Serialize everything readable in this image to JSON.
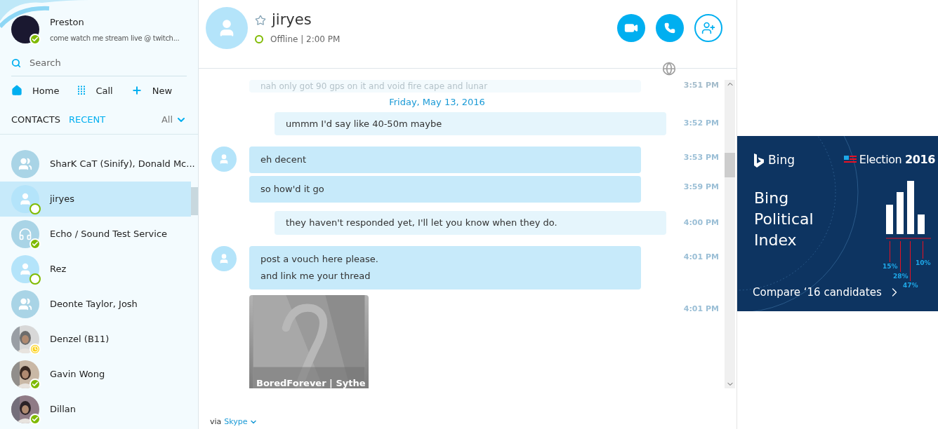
{
  "profile": {
    "name": "Preston",
    "mood": "come watch me stream live @ twitch...",
    "status": {
      "kind": "online"
    }
  },
  "search": {
    "placeholder": "Search"
  },
  "nav": [
    {
      "kind": "home",
      "label": "Home"
    },
    {
      "kind": "dialpad",
      "label": "Call"
    },
    {
      "kind": "plus",
      "label": "New"
    }
  ],
  "tabs": [
    {
      "label": "CONTACTS",
      "selected": false
    },
    {
      "label": "RECENT",
      "selected": true
    }
  ],
  "filter": "All",
  "contacts": [
    {
      "name": "SharK CaT (Sinify), Donald Mc...",
      "kind": "group",
      "selected": false
    },
    {
      "name": "jiryes",
      "kind": "person",
      "status": {
        "kind": "offline"
      },
      "selected": true
    },
    {
      "name": "Echo / Sound Test Service",
      "kind": "headset",
      "status": {
        "kind": "online"
      },
      "selected": false
    },
    {
      "name": "Rez",
      "kind": "person",
      "status": {
        "kind": "offline"
      },
      "selected": false
    },
    {
      "name": "Deonte Taylor, Josh",
      "kind": "group",
      "selected": false
    },
    {
      "name": "Denzel (B11)",
      "kind": "picture",
      "status": {
        "kind": "away"
      },
      "selected": false
    },
    {
      "name": "Gavin Wong",
      "kind": "picture",
      "status": {
        "kind": "online"
      },
      "selected": false
    },
    {
      "name": "Dillan",
      "kind": "picture",
      "status": {
        "kind": "online"
      },
      "selected": false
    }
  ],
  "chat": {
    "name": "jiryes",
    "favorite": false,
    "online": false,
    "status_text": "Offline | 2:00 PM"
  },
  "actions": [
    {
      "kind": "video"
    },
    {
      "kind": "call"
    },
    {
      "kind": "add-contact"
    }
  ],
  "messages": [
    {
      "kind": "faded",
      "lines": [
        "nah only got 90 gps on it and void fire cape and lunar"
      ],
      "time": "3:51 PM"
    },
    {
      "kind": "date",
      "text": "Friday, May 13, 2016"
    },
    {
      "kind": "outgoing",
      "lines": [
        "ummm I'd say like 40-50m maybe"
      ],
      "time": "3:52 PM"
    },
    {
      "kind": "incoming",
      "avatar": true,
      "lines": [
        "eh decent"
      ],
      "time": "3:53 PM"
    },
    {
      "kind": "incoming",
      "avatar": false,
      "lines": [
        "so how'd it go"
      ],
      "time": "3:59 PM"
    },
    {
      "kind": "outgoing",
      "lines": [
        "they haven't responded yet, I'll let you know when they do."
      ],
      "time": "4:00 PM"
    },
    {
      "kind": "incoming",
      "avatar": true,
      "lines": [
        "post a vouch here please.",
        "and link me your thread"
      ],
      "time": "4:01 PM"
    },
    {
      "kind": "attachment",
      "title": "BoredForever | Sythe",
      "time": "4:01 PM"
    }
  ],
  "footer": {
    "prefix": "via",
    "link": "Skype"
  },
  "ad": {
    "brand": "Bing",
    "badge_word": "Election",
    "badge_year": "2016",
    "headline": [
      "Bing",
      "Political",
      "Index"
    ],
    "cta": "Compare ‘16 candidates",
    "percents": [
      "15%",
      "28%",
      "47%",
      "10%"
    ]
  }
}
